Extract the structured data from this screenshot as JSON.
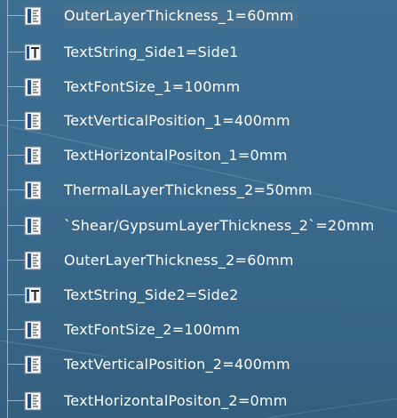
{
  "colors": {
    "background": "#3a6a8e",
    "tree_line": "#a9c0d3",
    "text": "#ffffff",
    "selection": "#4a708e"
  },
  "tree": {
    "items": [
      {
        "label": "OuterLayerThickness_1=60mm",
        "icon": "length-parameter-icon"
      },
      {
        "label": "TextString_Side1=Side1",
        "icon": "string-parameter-icon"
      },
      {
        "label": "TextFontSize_1=100mm",
        "icon": "length-parameter-icon"
      },
      {
        "label": "TextVerticalPosition_1=400mm",
        "icon": "length-parameter-icon"
      },
      {
        "label": "TextHorizontalPositon_1=0mm",
        "icon": "length-parameter-icon"
      },
      {
        "label": "ThermalLayerThickness_2=50mm",
        "icon": "length-parameter-icon"
      },
      {
        "label": "`Shear/GypsumLayerThickness_2`=20mm",
        "icon": "length-parameter-icon"
      },
      {
        "label": "OuterLayerThickness_2=60mm",
        "icon": "length-parameter-icon"
      },
      {
        "label": "TextString_Side2=Side2",
        "icon": "string-parameter-icon"
      },
      {
        "label": "TextFontSize_2=100mm",
        "icon": "length-parameter-icon"
      },
      {
        "label": "TextVerticalPosition_2=400mm",
        "icon": "length-parameter-icon"
      },
      {
        "label": "TextHorizontalPositon_2=0mm",
        "icon": "length-parameter-icon"
      }
    ]
  }
}
